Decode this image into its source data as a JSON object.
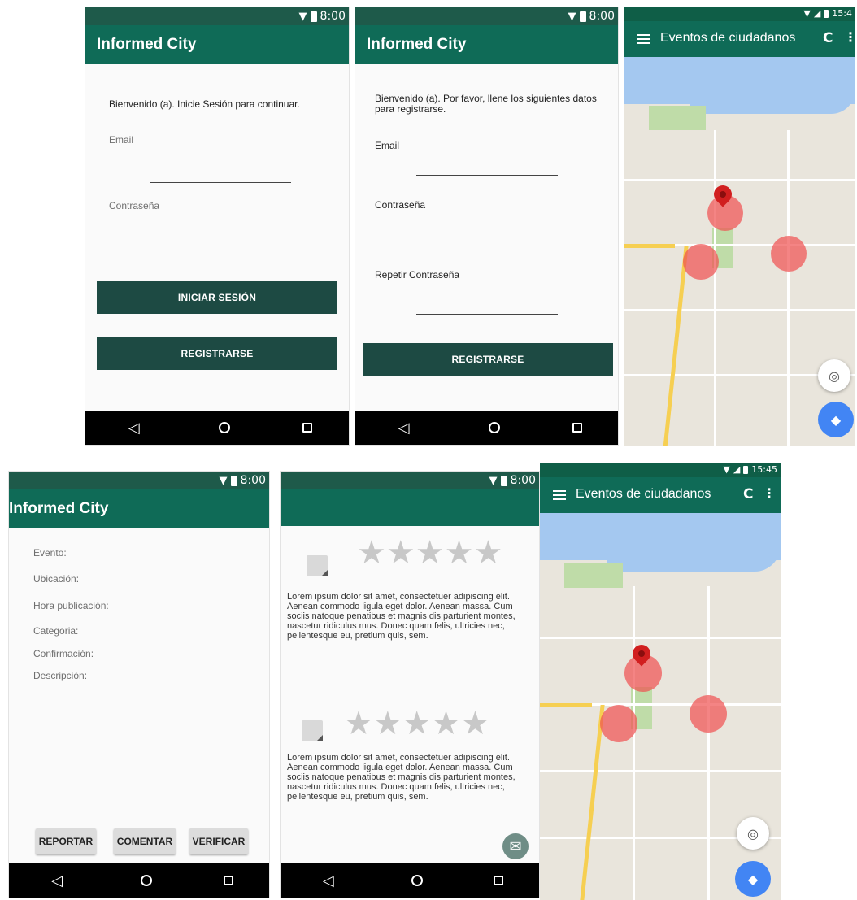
{
  "status": {
    "time": "8:00",
    "time_map_top": "15:4",
    "time_map_bottom": "15:45"
  },
  "login": {
    "app_title": "Informed City",
    "welcome": "Bienvenido (a). Inicie Sesión para continuar.",
    "email_label": "Email",
    "password_label": "Contraseña",
    "login_button": "INICIAR SESIÓN",
    "register_button": "REGISTRARSE"
  },
  "register": {
    "app_title": "Informed City",
    "welcome": "Bienvenido (a). Por favor, llene los siguientes datos para registrarse.",
    "email_label": "Email",
    "password_label": "Contraseña",
    "repeat_password_label": "Repetir Contraseña",
    "register_button": "REGISTRARSE"
  },
  "map": {
    "title": "Eventos de ciudadanos",
    "icons": [
      "menu-icon",
      "refresh-icon",
      "more-vert-icon",
      "my-location-icon",
      "directions-icon"
    ],
    "colors": {
      "marker_circle": "#f05050",
      "fab_blue": "#4285f4"
    }
  },
  "detail": {
    "app_title": "Informed City",
    "fields": [
      "Evento:",
      "Ubicación:",
      "Hora publicación:",
      "Categoria:",
      "Confirmación:",
      "Descripción:"
    ],
    "report_button": "REPORTAR",
    "comment_button": "COMENTAR",
    "verify_button": "VERIFICAR"
  },
  "comments": {
    "items": [
      {
        "stars": "★★★★★",
        "text": "Lorem ipsum dolor sit amet, consectetuer adipiscing elit. Aenean commodo ligula eget dolor. Aenean massa. Cum sociis natoque penatibus et magnis dis parturient montes, nascetur ridiculus mus. Donec quam felis, ultricies nec, pellentesque eu, pretium quis, sem."
      },
      {
        "stars": "★★★★★",
        "text": "Lorem ipsum dolor sit amet, consectetuer adipiscing elit. Aenean commodo ligula eget dolor. Aenean massa. Cum sociis natoque penatibus et magnis dis parturient montes, nascetur ridiculus mus. Donec quam felis, ultricies nec, pellentesque eu, pretium quis, sem."
      }
    ],
    "mail_icon": "✉"
  },
  "nav": {
    "back": "◁",
    "home": "○",
    "recent": "□"
  }
}
